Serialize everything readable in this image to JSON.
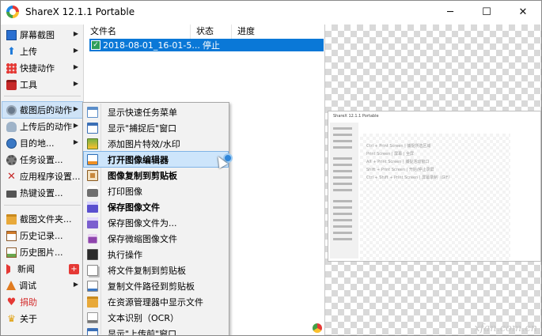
{
  "window": {
    "title": "ShareX 12.1.1 Portable",
    "minimize": "─",
    "maximize": "☐",
    "close": "✕"
  },
  "main_menu": [
    {
      "label": "屏幕截图",
      "icon": "monitor-icon",
      "arrow": true
    },
    {
      "label": "上传",
      "icon": "upload-arrow-icon",
      "arrow": true
    },
    {
      "label": "快捷动作",
      "icon": "grid-icon",
      "arrow": true
    },
    {
      "label": "工具",
      "icon": "toolbox-icon",
      "arrow": true
    },
    {
      "label": "截图后的动作",
      "icon": "gears-icon",
      "arrow": true,
      "selected": true
    },
    {
      "label": "上传后的动作",
      "icon": "cloud-icon",
      "arrow": true
    },
    {
      "label": "目的地...",
      "icon": "globe-icon",
      "arrow": true
    },
    {
      "label": "任务设置...",
      "icon": "gear-icon",
      "arrow": false
    },
    {
      "label": "应用程序设置...",
      "icon": "tools-icon",
      "arrow": false
    },
    {
      "label": "热键设置...",
      "icon": "keyboard-icon",
      "arrow": false
    },
    {
      "label": "截图文件夹...",
      "icon": "folder-icon",
      "arrow": false
    },
    {
      "label": "历史记录...",
      "icon": "history-icon",
      "arrow": false
    },
    {
      "label": "历史图片...",
      "icon": "images-icon",
      "arrow": false
    },
    {
      "label": "新闻",
      "icon": "megaphone-icon",
      "arrow": false,
      "badge": "+"
    },
    {
      "label": "调试",
      "icon": "bug-icon",
      "arrow": true
    },
    {
      "label": "捐助",
      "icon": "heart-icon",
      "arrow": false,
      "red": true
    },
    {
      "label": "关于",
      "icon": "crown-icon",
      "arrow": false
    }
  ],
  "task_list": {
    "columns": [
      "文件名",
      "状态",
      "进度"
    ],
    "rows": [
      {
        "filename": "2018-08-01_16-01-5...",
        "status": "停止",
        "progress": ""
      }
    ]
  },
  "submenu": [
    {
      "label": "显示快速任务菜单",
      "icon": "menu-list-icon"
    },
    {
      "label": "显示\"捕捉后\"窗口",
      "icon": "window-icon"
    },
    {
      "label": "添加图片特效/水印",
      "icon": "image-effect-icon"
    },
    {
      "label": "打开图像编辑器",
      "icon": "image-editor-icon",
      "highlighted": true,
      "bold": true
    },
    {
      "label": "图像复制到剪贴板",
      "icon": "clipboard-icon",
      "bold": true
    },
    {
      "label": "打印图像",
      "icon": "printer-icon"
    },
    {
      "label": "保存图像文件",
      "icon": "save-icon",
      "bold": true
    },
    {
      "label": "保存图像文件为...",
      "icon": "save-as-icon"
    },
    {
      "label": "保存微缩图像文件",
      "icon": "thumbnail-save-icon"
    },
    {
      "label": "执行操作",
      "icon": "terminal-icon"
    },
    {
      "label": "将文件复制到剪贴板",
      "icon": "file-copy-icon"
    },
    {
      "label": "复制文件路径到剪贴板",
      "icon": "path-copy-icon"
    },
    {
      "label": "在资源管理器中显示文件",
      "icon": "explorer-icon"
    },
    {
      "label": "文本识别（OCR）",
      "icon": "ocr-icon"
    },
    {
      "label": "显示\"上传前\"窗口",
      "icon": "upload-window-icon"
    }
  ],
  "preview_thumbnail": {
    "title": "ShareX 12.1.1 Portable",
    "hint_lines": [
      "Ctrl + Print Screen  |  捕捉所选区域",
      "Print Screen  |  屏幕 | 全屏",
      "Alt + Print Screen  |  捕捉活动窗口",
      "Shift + Print Screen  |  开始/停止录屏",
      "Ctrl + Shift + Print Screen  |  屏幕录制（GIF）"
    ]
  },
  "watermark": "xfan.com.cn",
  "colors": {
    "selection_blue": "#0a78d7",
    "menu_bg": "#f2f2f2",
    "highlight": "#cde5fb"
  }
}
